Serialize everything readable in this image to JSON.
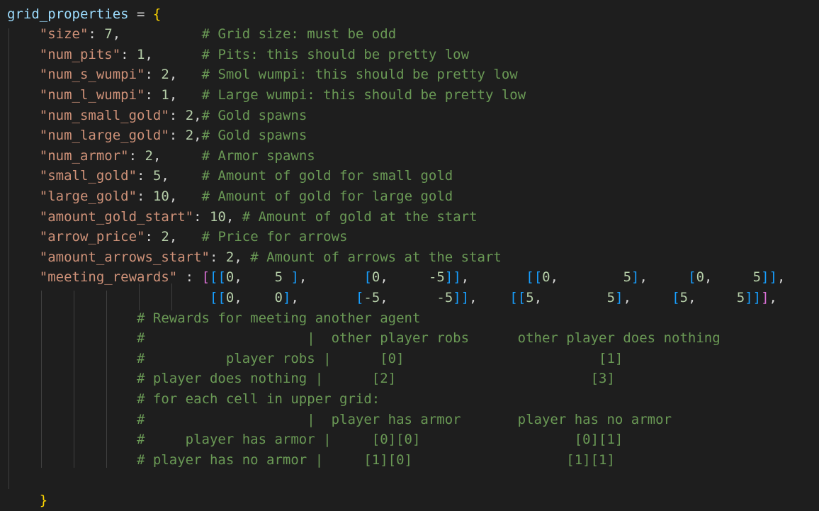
{
  "theme": {
    "background": "#1e1e1e",
    "text": "#d4d4d4",
    "variable": "#9cdcfe",
    "string": "#ce9178",
    "number": "#b5cea8",
    "comment": "#6a9955",
    "bracket_level_1": "#ffd700",
    "bracket_level_2": "#da70d6",
    "bracket_level_3": "#179fff",
    "indent_guide": "#404040"
  },
  "code": {
    "lines": [
      [
        [
          "var",
          "grid_properties"
        ],
        [
          "op",
          " = "
        ],
        [
          "b1",
          "{"
        ]
      ],
      [
        [
          "op",
          "    "
        ],
        [
          "str",
          "\"size\""
        ],
        [
          "op",
          ": "
        ],
        [
          "num",
          "7"
        ],
        [
          "op",
          ",          "
        ],
        [
          "cmt",
          "# Grid size: must be odd"
        ]
      ],
      [
        [
          "op",
          "    "
        ],
        [
          "str",
          "\"num_pits\""
        ],
        [
          "op",
          ": "
        ],
        [
          "num",
          "1"
        ],
        [
          "op",
          ",      "
        ],
        [
          "cmt",
          "# Pits: this should be pretty low"
        ]
      ],
      [
        [
          "op",
          "    "
        ],
        [
          "str",
          "\"num_s_wumpi\""
        ],
        [
          "op",
          ": "
        ],
        [
          "num",
          "2"
        ],
        [
          "op",
          ",   "
        ],
        [
          "cmt",
          "# Smol wumpi: this should be pretty low"
        ]
      ],
      [
        [
          "op",
          "    "
        ],
        [
          "str",
          "\"num_l_wumpi\""
        ],
        [
          "op",
          ": "
        ],
        [
          "num",
          "1"
        ],
        [
          "op",
          ",   "
        ],
        [
          "cmt",
          "# Large wumpi: this should be pretty low"
        ]
      ],
      [
        [
          "op",
          "    "
        ],
        [
          "str",
          "\"num_small_gold\""
        ],
        [
          "op",
          ": "
        ],
        [
          "num",
          "2"
        ],
        [
          "op",
          ","
        ],
        [
          "cmt",
          "# Gold spawns"
        ]
      ],
      [
        [
          "op",
          "    "
        ],
        [
          "str",
          "\"num_large_gold\""
        ],
        [
          "op",
          ": "
        ],
        [
          "num",
          "2"
        ],
        [
          "op",
          ","
        ],
        [
          "cmt",
          "# Gold spawns"
        ]
      ],
      [
        [
          "op",
          "    "
        ],
        [
          "str",
          "\"num_armor\""
        ],
        [
          "op",
          ": "
        ],
        [
          "num",
          "2"
        ],
        [
          "op",
          ",     "
        ],
        [
          "cmt",
          "# Armor spawns"
        ]
      ],
      [
        [
          "op",
          "    "
        ],
        [
          "str",
          "\"small_gold\""
        ],
        [
          "op",
          ": "
        ],
        [
          "num",
          "5"
        ],
        [
          "op",
          ",    "
        ],
        [
          "cmt",
          "# Amount of gold for small gold"
        ]
      ],
      [
        [
          "op",
          "    "
        ],
        [
          "str",
          "\"large_gold\""
        ],
        [
          "op",
          ": "
        ],
        [
          "num",
          "10"
        ],
        [
          "op",
          ",   "
        ],
        [
          "cmt",
          "# Amount of gold for large gold"
        ]
      ],
      [
        [
          "op",
          "    "
        ],
        [
          "str",
          "\"amount_gold_start\""
        ],
        [
          "op",
          ": "
        ],
        [
          "num",
          "10"
        ],
        [
          "op",
          ", "
        ],
        [
          "cmt",
          "# Amount of gold at the start"
        ]
      ],
      [
        [
          "op",
          "    "
        ],
        [
          "str",
          "\"arrow_price\""
        ],
        [
          "op",
          ": "
        ],
        [
          "num",
          "2"
        ],
        [
          "op",
          ",   "
        ],
        [
          "cmt",
          "# Price for arrows"
        ]
      ],
      [
        [
          "op",
          "    "
        ],
        [
          "str",
          "\"amount_arrows_start\""
        ],
        [
          "op",
          ": "
        ],
        [
          "num",
          "2"
        ],
        [
          "op",
          ", "
        ],
        [
          "cmt",
          "# Amount of arrows at the start"
        ]
      ],
      [
        [
          "op",
          "    "
        ],
        [
          "str",
          "\"meeting_rewards\""
        ],
        [
          "op",
          " : "
        ],
        [
          "b2",
          "["
        ],
        [
          "b3",
          "[["
        ],
        [
          "num",
          "0"
        ],
        [
          "op",
          ",    "
        ],
        [
          "num",
          "5"
        ],
        [
          "op",
          " "
        ],
        [
          "b3",
          "]"
        ],
        [
          "op",
          ",       "
        ],
        [
          "b3",
          "["
        ],
        [
          "num",
          "0"
        ],
        [
          "op",
          ",     "
        ],
        [
          "num",
          "-5"
        ],
        [
          "b3",
          "]]"
        ],
        [
          "op",
          ",       "
        ],
        [
          "b3",
          "[["
        ],
        [
          "num",
          "0"
        ],
        [
          "op",
          ",        "
        ],
        [
          "num",
          "5"
        ],
        [
          "b3",
          "]"
        ],
        [
          "op",
          ",     "
        ],
        [
          "b3",
          "["
        ],
        [
          "num",
          "0"
        ],
        [
          "op",
          ",     "
        ],
        [
          "num",
          "5"
        ],
        [
          "b3",
          "]]"
        ],
        [
          "op",
          ","
        ]
      ],
      [
        [
          "op",
          "                         "
        ],
        [
          "b3",
          "[["
        ],
        [
          "num",
          "0"
        ],
        [
          "op",
          ",    "
        ],
        [
          "num",
          "0"
        ],
        [
          "b3",
          "]"
        ],
        [
          "op",
          ",       "
        ],
        [
          "b3",
          "["
        ],
        [
          "num",
          "-5"
        ],
        [
          "op",
          ",      "
        ],
        [
          "num",
          "-5"
        ],
        [
          "b3",
          "]]"
        ],
        [
          "op",
          ",    "
        ],
        [
          "b3",
          "[["
        ],
        [
          "num",
          "5"
        ],
        [
          "op",
          ",        "
        ],
        [
          "num",
          "5"
        ],
        [
          "b3",
          "]"
        ],
        [
          "op",
          ",     "
        ],
        [
          "b3",
          "["
        ],
        [
          "num",
          "5"
        ],
        [
          "op",
          ",     "
        ],
        [
          "num",
          "5"
        ],
        [
          "b3",
          "]]"
        ],
        [
          "b2",
          "]"
        ],
        [
          "op",
          ","
        ]
      ],
      [
        [
          "op",
          "                "
        ],
        [
          "cmt",
          "# Rewards for meeting another agent"
        ]
      ],
      [
        [
          "op",
          "                "
        ],
        [
          "cmt",
          "#                    |  other player robs      other player does nothing"
        ]
      ],
      [
        [
          "op",
          "                "
        ],
        [
          "cmt",
          "#          player robs |      [0]                        [1]"
        ]
      ],
      [
        [
          "op",
          "                "
        ],
        [
          "cmt",
          "# player does nothing |      [2]                        [3]"
        ]
      ],
      [
        [
          "op",
          "                "
        ],
        [
          "cmt",
          "# for each cell in upper grid:"
        ]
      ],
      [
        [
          "op",
          "                "
        ],
        [
          "cmt",
          "#                    |  player has armor       player has no armor"
        ]
      ],
      [
        [
          "op",
          "                "
        ],
        [
          "cmt",
          "#     player has armor |     [0][0]                   [0][1]"
        ]
      ],
      [
        [
          "op",
          "                "
        ],
        [
          "cmt",
          "# player has no armor |     [1][0]                   [1][1]"
        ]
      ],
      [
        [
          "op",
          ""
        ]
      ],
      [
        [
          "op",
          "    "
        ],
        [
          "b1",
          "}"
        ]
      ]
    ]
  }
}
